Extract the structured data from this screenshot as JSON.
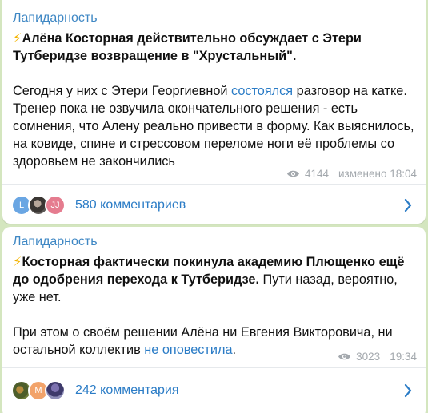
{
  "colors": {
    "background": "#d4e6bf",
    "channel": "#3e87c4",
    "link": "#2b7cc6",
    "meta": "#a3a8ad",
    "bolt": "#f4b400"
  },
  "posts": [
    {
      "channel": "Лапидарность",
      "bolt_icon": "⚡",
      "headline": "Алёна Косторная действительно обсуждает с Этери Тутберидзе возвращение в \"Хрустальный\".",
      "body_before_link": "Сегодня у них с Этери Георгиевной ",
      "body_link": "состоялся",
      "body_after_link": " разговор на катке. Тренер пока не озвучила окончательного решения - есть сомнения, что Алену реально привести в форму. Как выяснилось, на ковиде, спине и стрессовом переломе ноги её проблемы со здоровьем не закончились",
      "views": "4144",
      "status": "изменено 18:04",
      "avatars": [
        "L",
        "",
        "JJ"
      ],
      "comments": "580 комментариев"
    },
    {
      "channel": "Лапидарность",
      "bolt_icon": "⚡",
      "headline": "Косторная фактически покинула академию Плющенко ещё до одобрения перехода к Тутберидзе.",
      "headline_tail": " Пути назад, вероятно, уже нет.",
      "body_before_link": "При этом о своём решении Алёна ни Евгения Викторовича, ни остальной коллектив ",
      "body_link": "не оповестила",
      "body_after_link": ".",
      "views": "3023",
      "status": "19:34",
      "avatars": [
        "",
        "M",
        ""
      ],
      "comments": "242 комментария"
    }
  ]
}
